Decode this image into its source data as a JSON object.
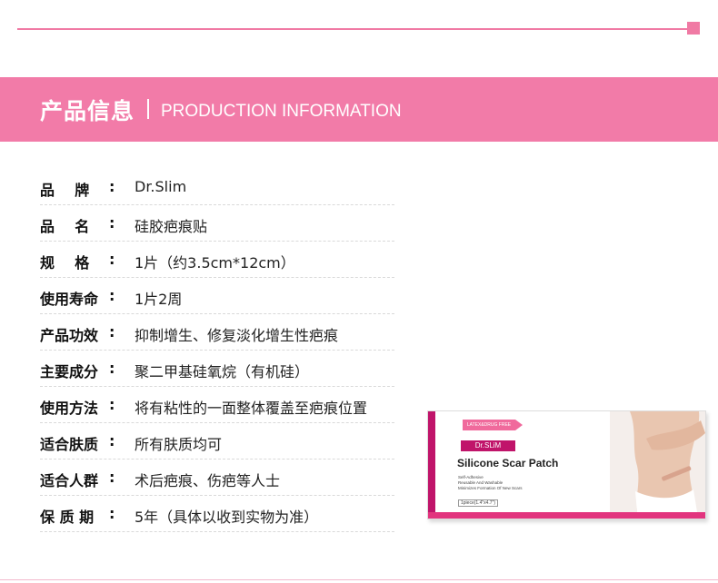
{
  "banner": {
    "title_cn": "产品信息",
    "title_en": "PRODUCTION INFORMATION"
  },
  "rows": [
    {
      "label": "品    牌",
      "value": "Dr.Slim"
    },
    {
      "label": "品    名",
      "value": "硅胶疤痕贴"
    },
    {
      "label": "规    格",
      "value": "1片（约3.5cm*12cm）"
    },
    {
      "label": "使用寿命",
      "value": "1片2周"
    },
    {
      "label": "产品功效",
      "value": "抑制增生、修复淡化增生性疤痕"
    },
    {
      "label": "主要成分",
      "value": "聚二甲基硅氧烷（有机硅）"
    },
    {
      "label": "使用方法",
      "value": "将有粘性的一面整体覆盖至疤痕位置"
    },
    {
      "label": "适合肤质",
      "value": "所有肤质均可"
    },
    {
      "label": "适合人群",
      "value": "术后疤痕、伤疤等人士"
    },
    {
      "label": "保 质 期",
      "value": "5年（具体以收到实物为准）"
    }
  ],
  "colon": ":",
  "product_box": {
    "ribbon": "LATEX&DRUG FREE",
    "brand": "Dr.SLiM",
    "name": "Silicone Scar Patch",
    "features": [
      "Self-Adhesive",
      "Reusable And Washable",
      "Minimizes Formation Of New Scars"
    ],
    "size": "1piece(1.4\"x4.7\")"
  },
  "colors": {
    "accent": "#f27ba8",
    "brand_dark": "#c0146a"
  }
}
